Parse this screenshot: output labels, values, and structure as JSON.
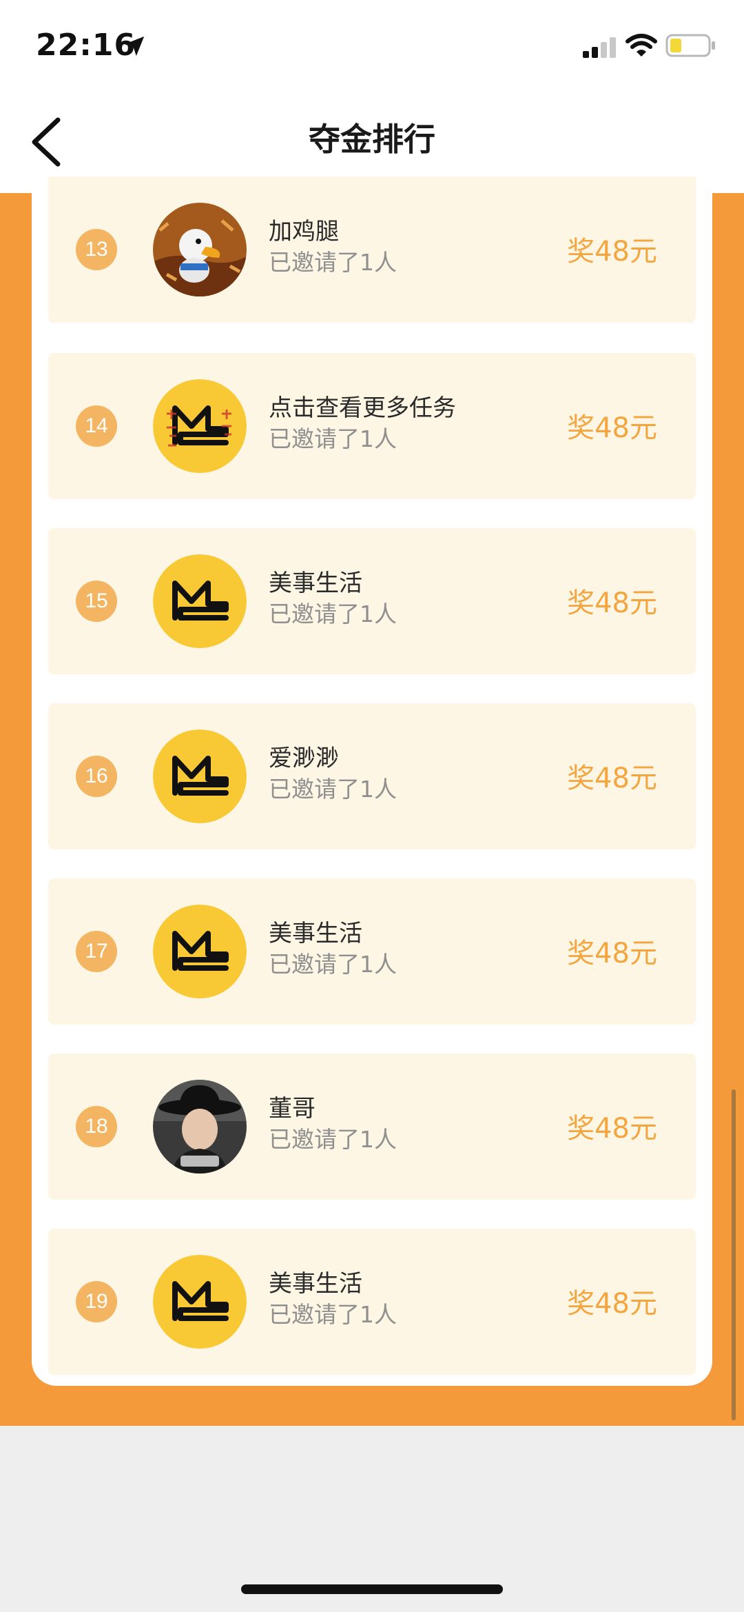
{
  "status_bar": {
    "time": "22:16"
  },
  "nav": {
    "title": "夺金排行"
  },
  "rows": [
    {
      "rank": "13",
      "name": "加鸡腿",
      "invited": "已邀请了1人",
      "reward": "奖48元",
      "avatar": "duck-avatar"
    },
    {
      "rank": "14",
      "name": "点击查看更多任务",
      "invited": "已邀请了1人",
      "reward": "奖48元",
      "avatar": "ms-logo-avatar"
    },
    {
      "rank": "15",
      "name": "美事生活",
      "invited": "已邀请了1人",
      "reward": "奖48元",
      "avatar": "ms-logo-avatar"
    },
    {
      "rank": "16",
      "name": "爱渺渺",
      "invited": "已邀请了1人",
      "reward": "奖48元",
      "avatar": "ms-logo-avatar"
    },
    {
      "rank": "17",
      "name": "美事生活",
      "invited": "已邀请了1人",
      "reward": "奖48元",
      "avatar": "ms-logo-avatar"
    },
    {
      "rank": "18",
      "name": "董哥",
      "invited": "已邀请了1人",
      "reward": "奖48元",
      "avatar": "person-hat-avatar"
    },
    {
      "rank": "19",
      "name": "美事生活",
      "invited": "已邀请了1人",
      "reward": "奖48元",
      "avatar": "ms-logo-avatar"
    }
  ],
  "colors": {
    "accent": "#f59a3a",
    "row_bg": "#fef6e4",
    "badge": "#f3b562",
    "reward": "#f3a640",
    "logo_yellow": "#f8c935"
  }
}
